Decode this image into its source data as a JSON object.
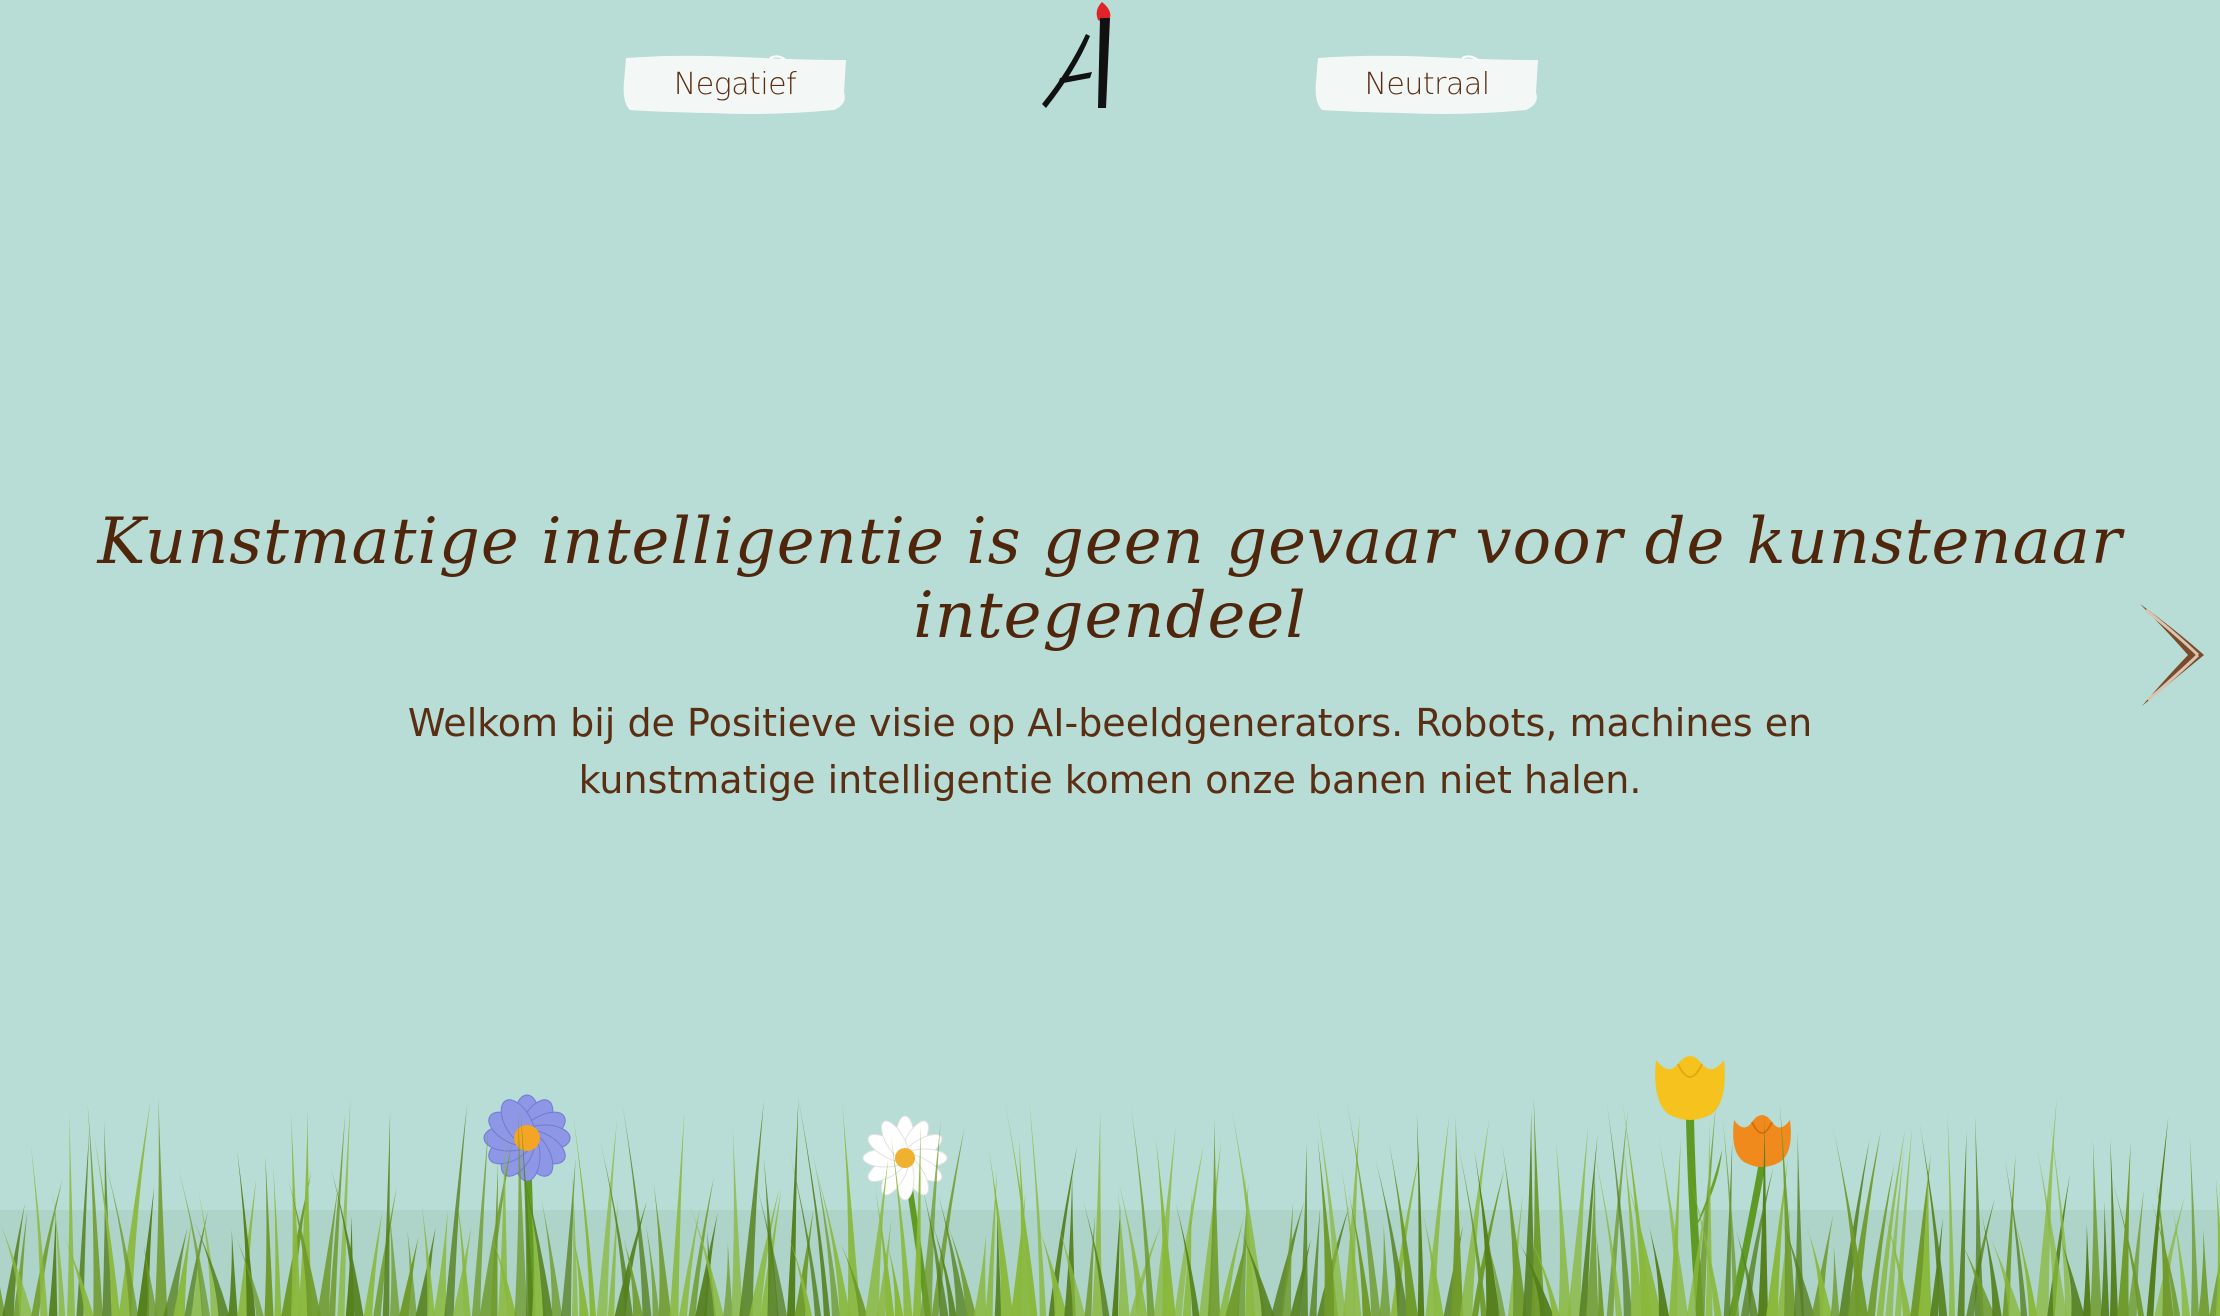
{
  "nav": {
    "negative_label": "Negatief",
    "neutral_label": "Neutraal"
  },
  "hero": {
    "title": "Kunstmatige intelligentie is geen gevaar voor de kunstenaar integendeel",
    "intro_line1": "Welkom bij de Positieve visie op AI-beeldgenerators. Robots, machines en",
    "intro_line2": "kunstmatige intelligentie komen onze banen niet halen."
  },
  "icons": {
    "logo": "ai-paintbrush-logo",
    "next": "chevron-right-icon"
  },
  "colors": {
    "background": "#b8dcd6",
    "text": "#5a2e12",
    "button": "#f3f8f7",
    "brush_tip": "#e0232b",
    "grass": "#6f9a2a"
  }
}
